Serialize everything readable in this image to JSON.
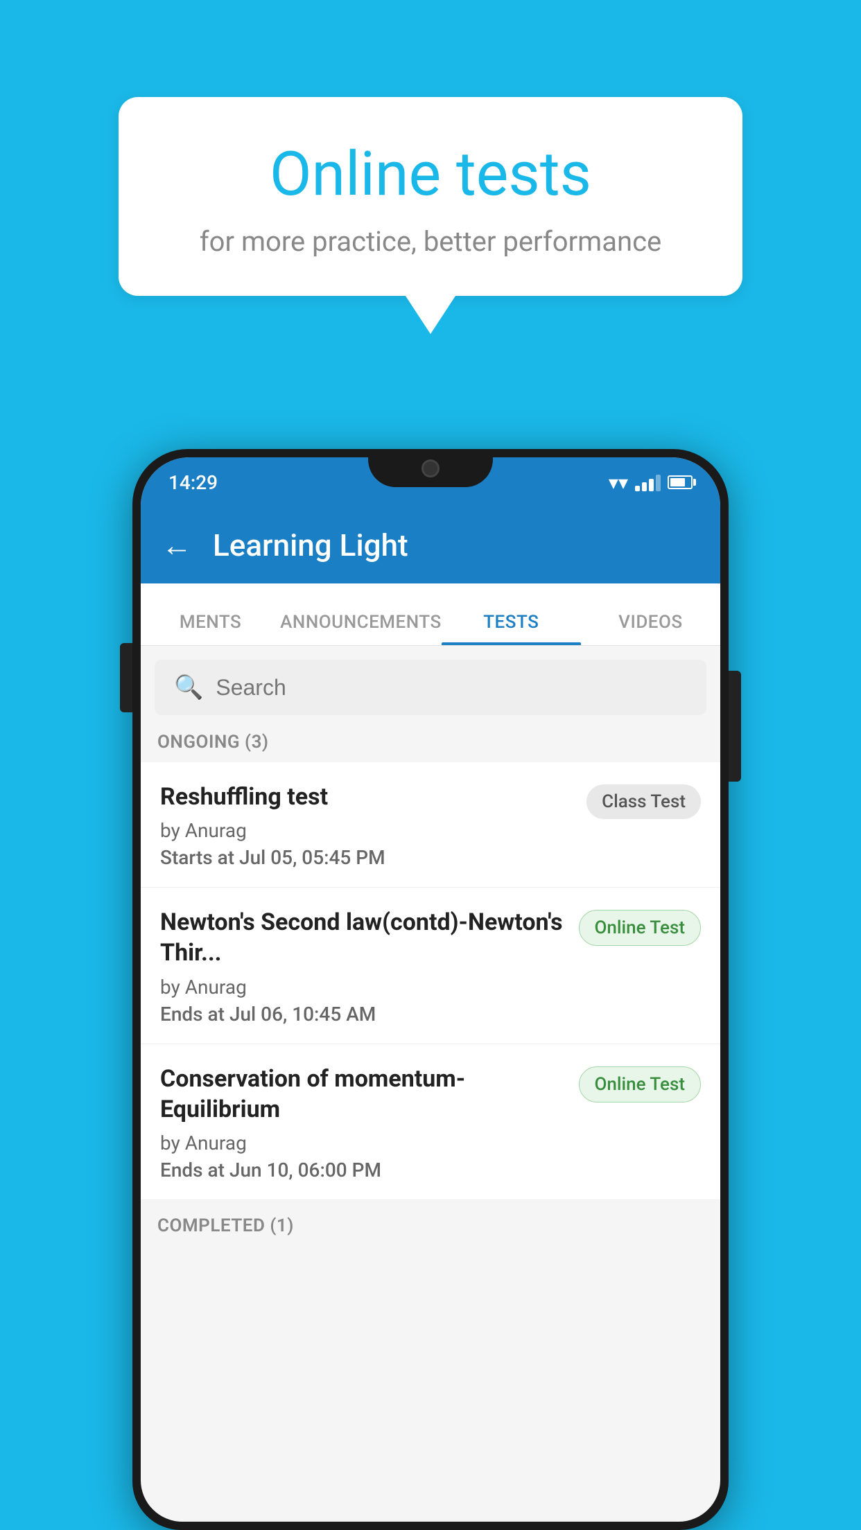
{
  "background_color": "#1ab8e8",
  "bubble": {
    "title": "Online tests",
    "subtitle": "for more practice, better performance"
  },
  "status_bar": {
    "time": "14:29",
    "wifi": "▼",
    "battery_level": 75
  },
  "app_bar": {
    "back_label": "←",
    "title": "Learning Light"
  },
  "tabs": [
    {
      "label": "MENTS",
      "active": false
    },
    {
      "label": "ANNOUNCEMENTS",
      "active": false
    },
    {
      "label": "TESTS",
      "active": true
    },
    {
      "label": "VIDEOS",
      "active": false
    }
  ],
  "search": {
    "placeholder": "Search"
  },
  "ongoing_section": {
    "label": "ONGOING (3)"
  },
  "tests": [
    {
      "name": "Reshuffling test",
      "author": "by Anurag",
      "time_label": "Starts at",
      "time_value": "Jul 05, 05:45 PM",
      "badge": "Class Test",
      "badge_type": "class"
    },
    {
      "name": "Newton's Second law(contd)-Newton's Thir...",
      "author": "by Anurag",
      "time_label": "Ends at",
      "time_value": "Jul 06, 10:45 AM",
      "badge": "Online Test",
      "badge_type": "online"
    },
    {
      "name": "Conservation of momentum-Equilibrium",
      "author": "by Anurag",
      "time_label": "Ends at",
      "time_value": "Jun 10, 06:00 PM",
      "badge": "Online Test",
      "badge_type": "online"
    }
  ],
  "completed_section": {
    "label": "COMPLETED (1)"
  }
}
